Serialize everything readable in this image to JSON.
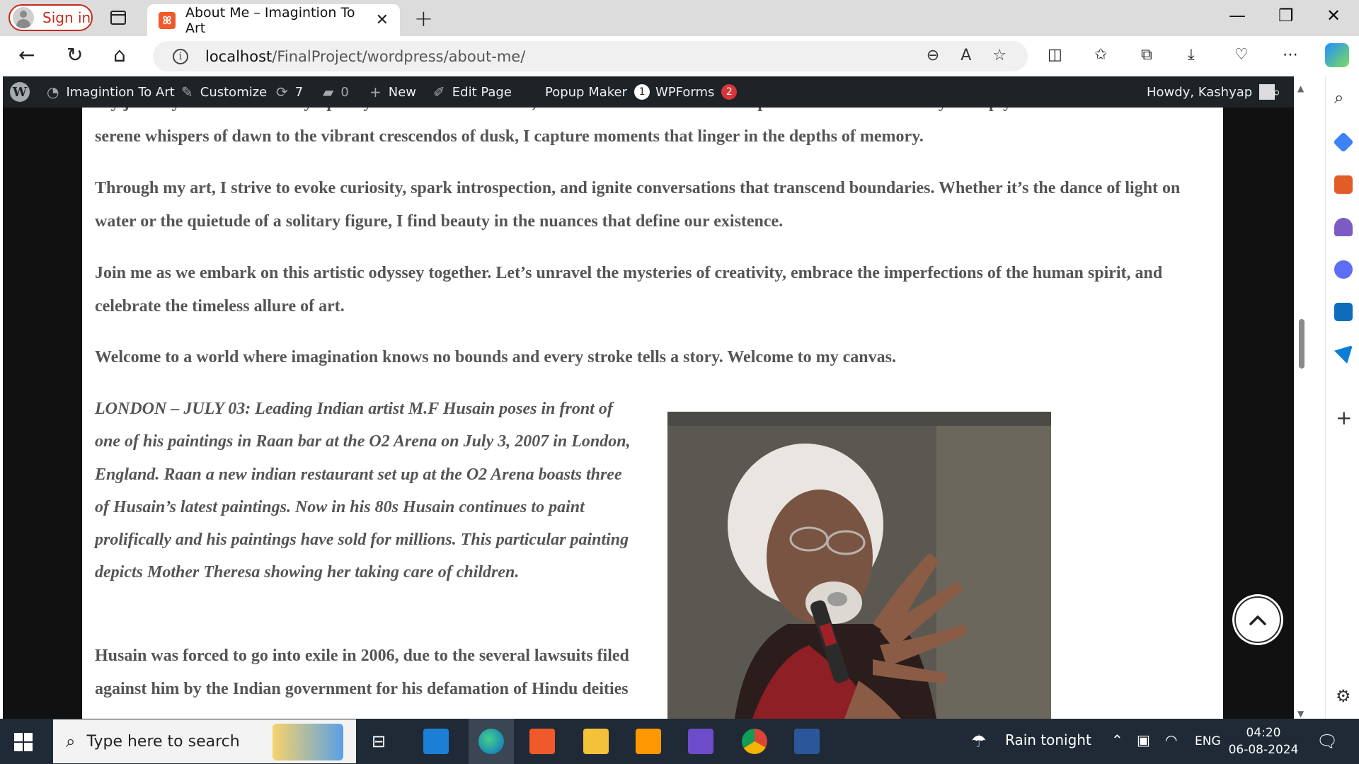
{
  "browser": {
    "signin_label": "Sign in",
    "tab_title": "About Me – Imagintion To Art",
    "url_host": "localhost",
    "url_path": "/FinalProject/wordpress/about-me/"
  },
  "wp_admin_bar": {
    "site_name": "Imagintion To Art",
    "customize": "Customize",
    "updates_count": "7",
    "comments_count": "0",
    "new_label": "New",
    "edit_page": "Edit Page",
    "popup_maker": "Popup Maker",
    "popup_maker_badge": "1",
    "wpforms": "WPForms",
    "wpforms_badge": "2",
    "howdy": "Howdy, Kashyap"
  },
  "article": {
    "cut_line_top": "My journey as an artist is a symphony of colors and textures, where each canvas becomes a portal to a world unseen yet deeply felt. From the",
    "para1": "serene whispers of dawn to the vibrant crescendos of dusk, I capture moments that linger in the depths of memory.",
    "para2": "Through my art, I strive to evoke curiosity, spark introspection, and ignite conversations that transcend boundaries. Whether it’s the dance of light on water or the quietude of a solitary figure, I find beauty in the nuances that define our existence.",
    "para3": "Join me as we embark on this artistic odyssey together. Let’s unravel the mysteries of creativity, embrace the imperfections of the human spirit, and celebrate the timeless allure of art.",
    "para4": "Welcome to a world where imagination knows no bounds and every stroke tells a story. Welcome to my canvas.",
    "caption": "LONDON – JULY 03: Leading Indian artist M.F Husain poses in front of one of his paintings in Raan bar at the O2 Arena on July 3, 2007 in London, England. Raan a new indian restaurant set up at the O2 Arena boasts three of Husain’s latest paintings. Now in his 80s Husain continues to paint prolifically and his paintings have sold for millions. This particular painting depicts Mother Theresa showing her taking care of children.",
    "para5": "Husain was forced to go into exile in 2006, due to the several lawsuits filed against him by the Indian government for his defamation of",
    "para5_cut": "Hindu deities"
  },
  "taskbar": {
    "search_placeholder": "Type here to search",
    "weather": "Rain tonight",
    "language": "ENG",
    "time": "04:20",
    "date": "06-08-2024"
  },
  "colors": {
    "wp_bar": "#1d2327",
    "badge_red": "#d63638",
    "signin_red": "#c42b1c",
    "taskbar": "#1f2a36",
    "body_text": "#555555"
  }
}
